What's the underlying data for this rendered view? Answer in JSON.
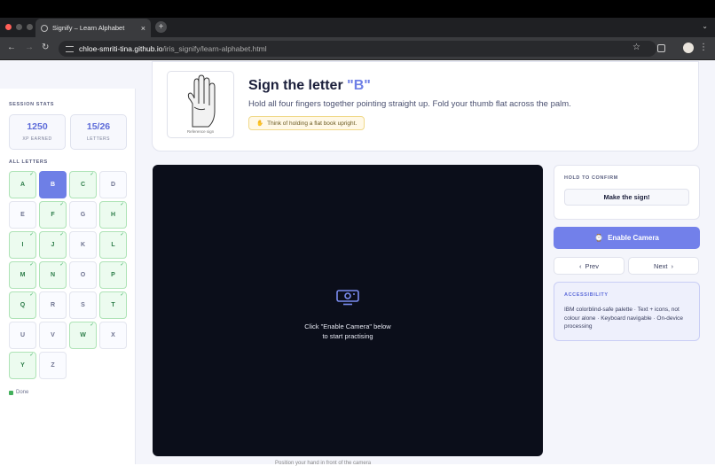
{
  "browser": {
    "tab_title": "Signify – Learn Alphabet",
    "tab_close": "×",
    "new_tab": "+",
    "url_host": "chloe-smriti-tina.github.io",
    "url_path": "/iris_signify/learn-alphabet.html",
    "colors": {
      "close": "#ff5f57",
      "minimize": "#febc2e",
      "maximize": "#28c840"
    }
  },
  "sidebar": {
    "stats_title": "SESSION STATS",
    "stats": [
      {
        "value": "1250",
        "label": "XP EARNED"
      },
      {
        "value": "15/26",
        "label": "LETTERS"
      }
    ],
    "letters_title": "ALL LETTERS",
    "letters": [
      {
        "letter": "A",
        "state": "done"
      },
      {
        "letter": "B",
        "state": "active"
      },
      {
        "letter": "C",
        "state": "done"
      },
      {
        "letter": "D",
        "state": "todo"
      },
      {
        "letter": "E",
        "state": "todo"
      },
      {
        "letter": "F",
        "state": "done"
      },
      {
        "letter": "G",
        "state": "todo"
      },
      {
        "letter": "H",
        "state": "done"
      },
      {
        "letter": "I",
        "state": "done"
      },
      {
        "letter": "J",
        "state": "done"
      },
      {
        "letter": "K",
        "state": "todo"
      },
      {
        "letter": "L",
        "state": "done"
      },
      {
        "letter": "M",
        "state": "done"
      },
      {
        "letter": "N",
        "state": "done"
      },
      {
        "letter": "O",
        "state": "todo"
      },
      {
        "letter": "P",
        "state": "done"
      },
      {
        "letter": "Q",
        "state": "done"
      },
      {
        "letter": "R",
        "state": "todo"
      },
      {
        "letter": "S",
        "state": "todo"
      },
      {
        "letter": "T",
        "state": "done"
      },
      {
        "letter": "U",
        "state": "todo"
      },
      {
        "letter": "V",
        "state": "todo"
      },
      {
        "letter": "W",
        "state": "done"
      },
      {
        "letter": "X",
        "state": "todo"
      },
      {
        "letter": "Y",
        "state": "done"
      },
      {
        "letter": "Z",
        "state": "todo"
      }
    ],
    "legend_label": "Done"
  },
  "header": {
    "title_prefix": "Sign the letter ",
    "title_letter": "\"B\"",
    "description": "Hold all four fingers together pointing straight up. Fold your thumb flat across the palm.",
    "hint": "Think of holding a flat book upright.",
    "image_caption": "Reference sign"
  },
  "camera": {
    "line1": "Click \"Enable Camera\" below",
    "line2": "to start practising",
    "below_text": "Position your hand in front of the camera"
  },
  "confirm": {
    "title": "HOLD TO CONFIRM",
    "button": "Make the sign!"
  },
  "controls": {
    "enable_camera": "Enable Camera",
    "prev": "Prev",
    "next": "Next"
  },
  "accessibility": {
    "title": "ACCESSIBILITY",
    "body": "IBM colorblind-safe palette · Text + icons, not colour alone · Keyboard navigable · On-device processing"
  },
  "colors": {
    "accent": "#6e7fe6",
    "done": "#43b05c",
    "camera_bg": "#0b0e1a"
  }
}
